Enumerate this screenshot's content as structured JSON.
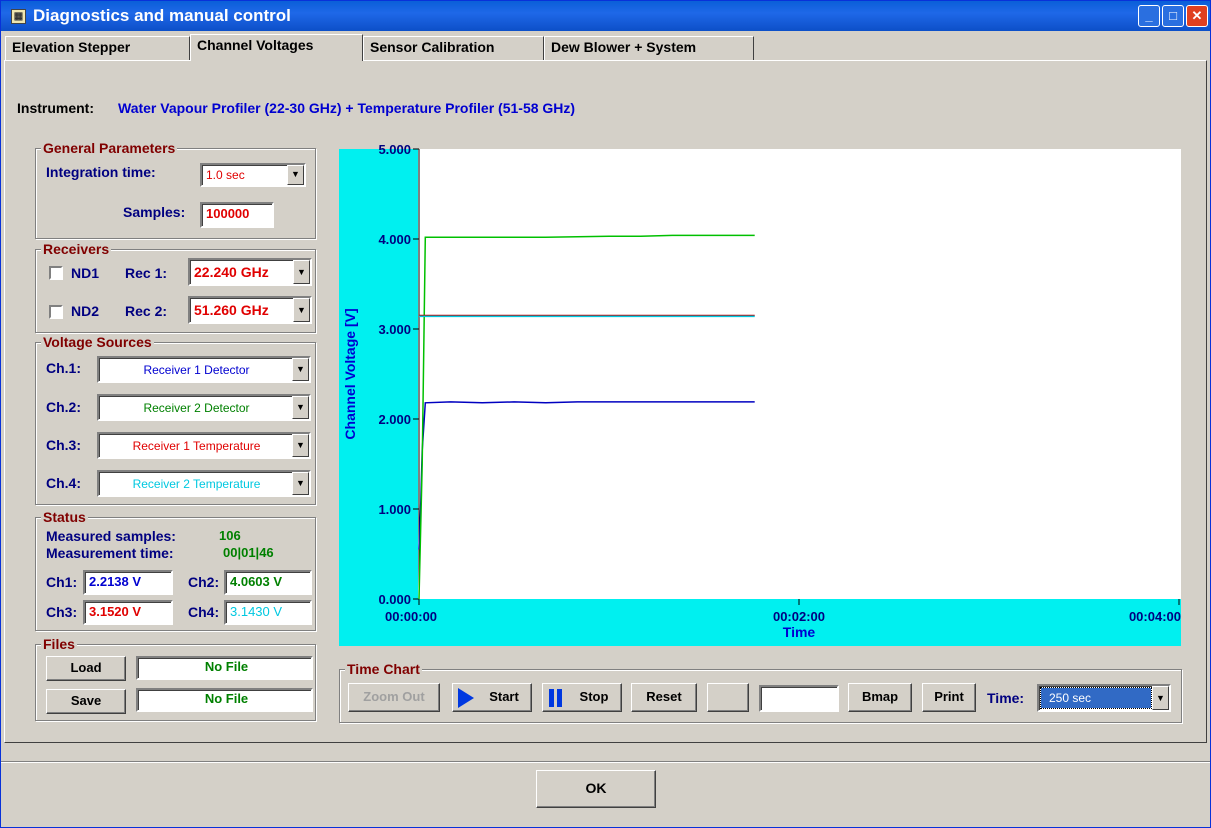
{
  "window": {
    "title": "Diagnostics and manual control",
    "app_icon": "app-icon",
    "controls": [
      "minimize-icon",
      "maximize-icon",
      "close-icon"
    ]
  },
  "tabs": [
    {
      "label": "Elevation Stepper"
    },
    {
      "label": "Channel Voltages",
      "selected": true
    },
    {
      "label": "Sensor Calibration"
    },
    {
      "label": "Dew Blower + System"
    }
  ],
  "instrument": {
    "label": "Instrument:",
    "value": "Water Vapour Profiler (22-30 GHz) + Temperature Profiler (51-58 GHz)"
  },
  "general": {
    "title": "General Parameters",
    "integration_label": "Integration time:",
    "integration_value": "1.0 sec",
    "samples_label": "Samples:",
    "samples_value": "100000"
  },
  "receivers": {
    "title": "Receivers",
    "rows": [
      {
        "nd": "ND1",
        "rec_label": "Rec 1:",
        "freq": "22.240 GHz",
        "checked": false
      },
      {
        "nd": "ND2",
        "rec_label": "Rec 2:",
        "freq": "51.260 GHz",
        "checked": false
      }
    ]
  },
  "voltage_sources": {
    "title": "Voltage Sources",
    "channels": [
      {
        "label": "Ch.1:",
        "value": "Receiver 1 Detector",
        "color": "#0000d0"
      },
      {
        "label": "Ch.2:",
        "value": "Receiver 2 Detector",
        "color": "#008000"
      },
      {
        "label": "Ch.3:",
        "value": "Receiver 1 Temperature",
        "color": "#e00000"
      },
      {
        "label": "Ch.4:",
        "value": "Receiver 2 Temperature",
        "color": "#00c8e0"
      }
    ]
  },
  "status": {
    "title": "Status",
    "measured_label": "Measured samples:",
    "measured_value": "106",
    "time_label": "Measurement time:",
    "time_value": "00|01|46",
    "readings": [
      {
        "label": "Ch1:",
        "value": "2.2138 V"
      },
      {
        "label": "Ch2:",
        "value": "4.0603 V"
      },
      {
        "label": "Ch3:",
        "value": "3.1520 V"
      },
      {
        "label": "Ch4:",
        "value": "3.1430 V"
      }
    ]
  },
  "files": {
    "title": "Files",
    "load_label": "Load",
    "load_file": "No File",
    "save_label": "Save",
    "save_file": "No File"
  },
  "time_chart": {
    "title": "Time Chart",
    "zoom_out": "Zoom Out",
    "start": "Start",
    "stop": "Stop",
    "reset": "Reset",
    "bmap": "Bmap",
    "print": "Print",
    "time_label": "Time:",
    "time_value": "250 sec"
  },
  "ok_label": "OK",
  "chart_data": {
    "type": "line",
    "xlabel": "Time",
    "ylabel": "Channel Voltage [V]",
    "ylim": [
      0,
      5
    ],
    "xlim": [
      0,
      240
    ],
    "x_ticks": [
      "00:00:00",
      "00:02:00",
      "00:04:00"
    ],
    "y_ticks": [
      "0.000",
      "1.000",
      "2.000",
      "3.000",
      "4.000",
      "5.000"
    ],
    "grid": false,
    "series": [
      {
        "color": "#0000c0",
        "x": [
          0,
          0.5,
          1,
          2,
          10,
          20,
          30,
          40,
          50,
          60,
          80,
          106
        ],
        "y": [
          0.55,
          1.0,
          1.65,
          2.18,
          2.19,
          2.18,
          2.19,
          2.18,
          2.19,
          2.19,
          2.19,
          2.19
        ]
      },
      {
        "color": "#00c000",
        "x": [
          0,
          1,
          2,
          20,
          40,
          60,
          70,
          80,
          106
        ],
        "y": [
          0.0,
          1.5,
          4.02,
          4.02,
          4.02,
          4.03,
          4.03,
          4.04,
          4.04
        ]
      },
      {
        "color": "#c00000",
        "x": [
          0,
          106
        ],
        "y": [
          3.15,
          3.15
        ]
      },
      {
        "color": "#00c8e0",
        "x": [
          0,
          106
        ],
        "y": [
          3.14,
          3.14
        ]
      }
    ]
  }
}
